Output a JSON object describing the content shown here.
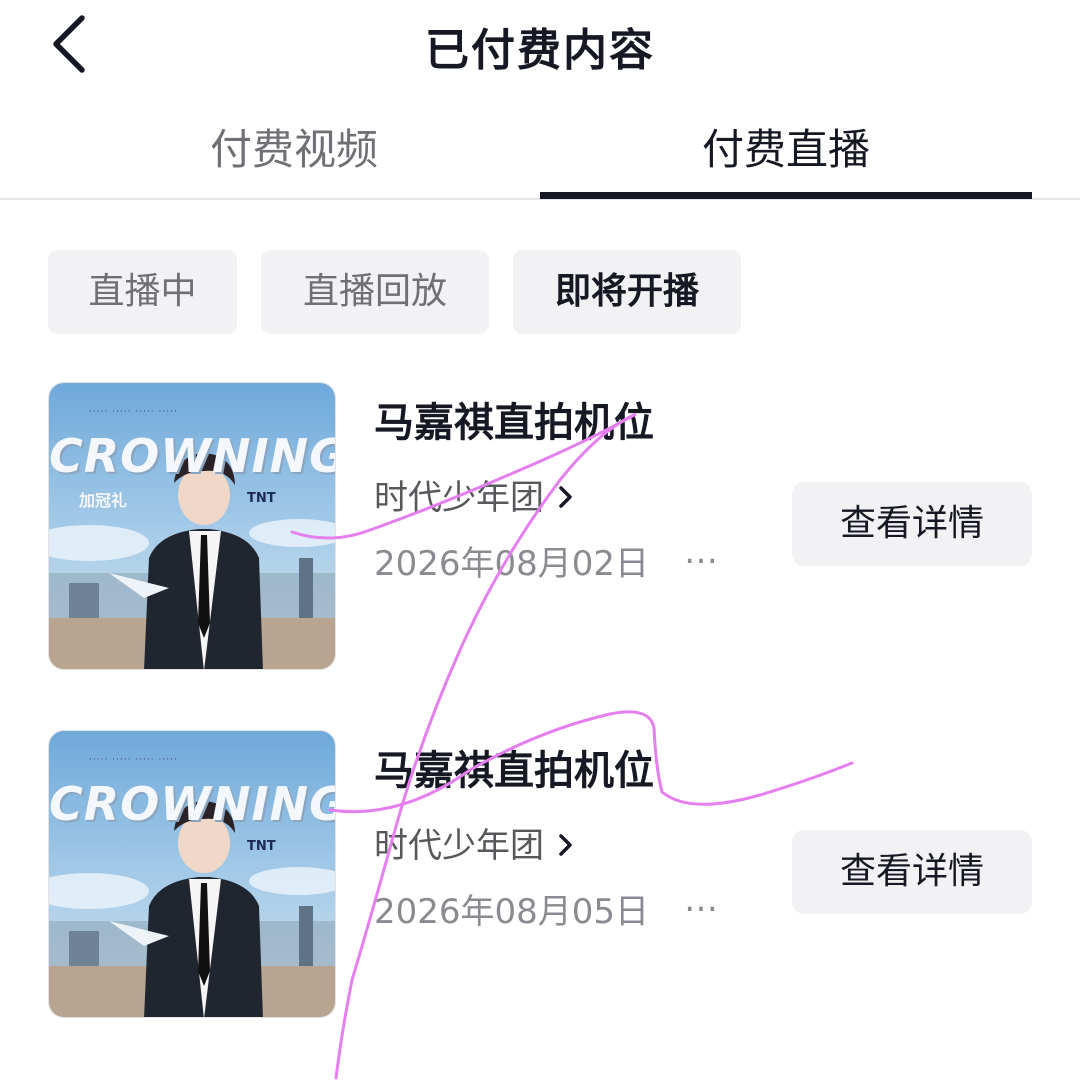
{
  "header": {
    "title": "已付费内容",
    "back_icon": "chevron-left-icon"
  },
  "tabs": [
    {
      "label": "付费视频",
      "active": false
    },
    {
      "label": "付费直播",
      "active": true
    }
  ],
  "filters": [
    {
      "label": "直播中",
      "active": false
    },
    {
      "label": "直播回放",
      "active": false
    },
    {
      "label": "即将开播",
      "active": true
    }
  ],
  "items": [
    {
      "thumbnail": {
        "title": "CROWNING",
        "subtitle": "加冠礼",
        "brand": "TNT",
        "colors": {
          "sky": "#7fb2dc",
          "suit": "#1f2630"
        }
      },
      "title": "马嘉祺直拍机位",
      "author": "时代少年团",
      "date": "2026年08月02日",
      "more": "…",
      "button_label": "查看详情"
    },
    {
      "thumbnail": {
        "title": "CROWNING",
        "subtitle": "",
        "brand": "TNT",
        "colors": {
          "sky": "#7fb2dc",
          "suit": "#1f2630"
        }
      },
      "title": "马嘉祺直拍机位",
      "author": "时代少年团",
      "date": "2026年08月05日",
      "more": "…",
      "button_label": "查看详情"
    }
  ],
  "colors": {
    "text_primary": "#161823",
    "text_secondary": "#6f7075",
    "chip_bg": "#f2f2f4",
    "scribble": "#e57ff0"
  }
}
